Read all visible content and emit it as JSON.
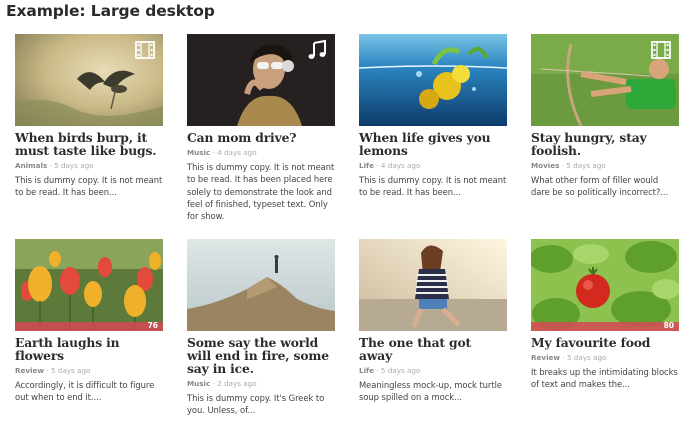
{
  "page": {
    "heading": "Example: Large desktop"
  },
  "cards": [
    {
      "title": "When birds burp, it must taste like bugs.",
      "category": "Animals",
      "time": "5 days ago",
      "excerpt": "This is dummy copy. It is not meant to be read. It has been...",
      "badge_icon": "film-icon"
    },
    {
      "title": "Can mom drive?",
      "category": "Music",
      "time": "4 days ago",
      "excerpt": "This is dummy copy. It is not meant to be read. It has been placed here solely to demonstrate the look and feel of finished, typeset text. Only for show.",
      "badge_icon": "music-note-icon"
    },
    {
      "title": "When life gives you lemons",
      "category": "Life",
      "time": "4 days ago",
      "excerpt": "This is dummy copy. It is not meant to be read. It has been..."
    },
    {
      "title": "Stay hungry, stay foolish.",
      "category": "Movies",
      "time": "5 days ago",
      "excerpt": "What other form of filler would dare be so politically incorrect?...",
      "badge_icon": "film-icon"
    },
    {
      "title": "Earth laughs in flowers",
      "category": "Review",
      "time": "5 days ago",
      "excerpt": "Accordingly, it is difficult to figure out when to end it....",
      "score": "76",
      "score_value": 76
    },
    {
      "title": "Some say the world will end in fire, some say in ice.",
      "category": "Music",
      "time": "2 days ago",
      "excerpt": "This is dummy copy. It's Greek to you. Unless, of..."
    },
    {
      "title": "The one that got away",
      "category": "Life",
      "time": "5 days ago",
      "excerpt": "Meaningless mock-up, mock turtle soup spilled on a mock..."
    },
    {
      "title": "My favourite food",
      "category": "Review",
      "time": "5 days ago",
      "excerpt": "It breaks up the intimidating blocks of text and makes the...",
      "score": "80",
      "score_value": 80
    }
  ],
  "colors": {
    "score_bar": "#d64856",
    "title": "#2b2b2b",
    "meta": "#aaaaaa"
  }
}
